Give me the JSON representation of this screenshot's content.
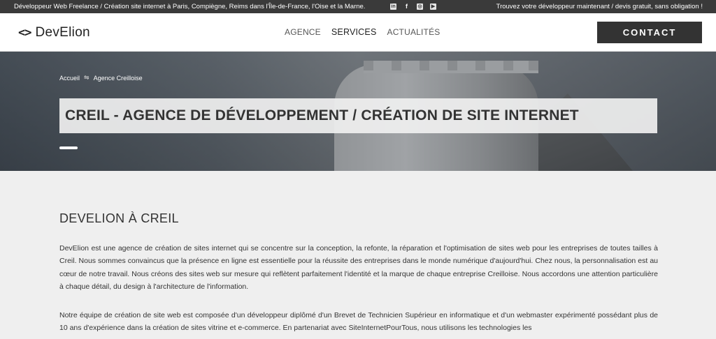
{
  "topbar": {
    "left_text": "Développeur Web Freelance / Création site internet à Paris, Compiègne, Reims dans l'Île-de-France, l'Oise et la Marne.",
    "right_text": "Trouvez votre développeur maintenant / devis gratuit, sans obligation !",
    "social_icons": [
      "linkedin-icon",
      "facebook-icon",
      "instagram-icon",
      "youtube-icon"
    ]
  },
  "header": {
    "logo_symbol": "<>",
    "logo_text": "DevElion",
    "nav": [
      {
        "label": "AGENCE"
      },
      {
        "label": "SERVICES"
      },
      {
        "label": "ACTUALITÉS"
      }
    ],
    "contact_label": "CONTACT"
  },
  "hero": {
    "breadcrumb_home": "Accueil",
    "breadcrumb_separator": "⇋",
    "breadcrumb_current": "Agence Creilloise",
    "title": "CREIL - AGENCE DE DÉVELOPPEMENT / CRÉATION DE SITE INTERNET"
  },
  "content": {
    "heading": "DEVELION À CREIL",
    "paragraph1": "DevElion est une agence de création de sites internet qui se concentre sur la conception, la refonte, la réparation et l'optimisation de sites web pour les entreprises de toutes tailles à Creil. Nous sommes convaincus que la présence en ligne est essentielle pour la réussite des entreprises dans le monde numérique d'aujourd'hui. Chez nous, la personnalisation est au cœur de notre travail. Nous créons des sites web sur mesure qui reflètent parfaitement l'identité et la marque de chaque entreprise Creilloise. Nous accordons une attention particulière à chaque détail, du design à l'architecture de l'information.",
    "paragraph2": "Notre équipe de création de site web est composée d'un développeur diplômé d'un Brevet de Technicien Supérieur en informatique et d'un webmaster expérimenté possédant plus de 10 ans d'expérience dans la création de sites vitrine et e-commerce. En partenariat avec SiteInternetPourTous, nous utilisons les technologies les"
  },
  "colors": {
    "topbar_bg": "#3a3a3a",
    "contact_bg": "#333333",
    "page_bg": "#efefef"
  }
}
